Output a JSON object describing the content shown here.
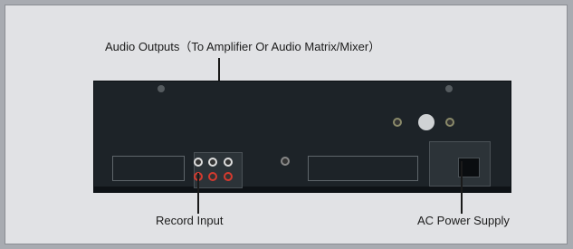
{
  "labels": {
    "audio_outputs": "Audio  Outputs（To  Amplifier Or Audio Matrix/Mixer）",
    "record_input": "Record Input",
    "ac_power_supply": "AC Power Supply"
  },
  "colors": {
    "background": "#a8abb1",
    "panel": "#e1e2e5",
    "device": "#1d2328",
    "red_jack": "#d43a2f"
  }
}
